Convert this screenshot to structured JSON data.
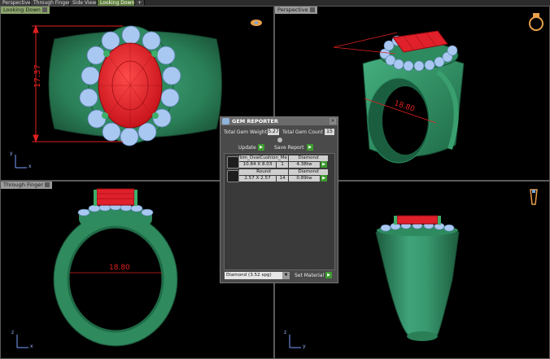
{
  "tabs": [
    {
      "label": "Perspective"
    },
    {
      "label": "Through Finger"
    },
    {
      "label": "Side View"
    },
    {
      "label": "Looking Down"
    },
    {
      "label": "+"
    }
  ],
  "viewports": {
    "top_left": {
      "label": "Looking Down",
      "dimension": "17.37"
    },
    "top_right": {
      "label": "Perspective",
      "dimension": "18.80"
    },
    "bottom_left": {
      "label": "Through Finger",
      "dimension": "18.80"
    },
    "bottom_right": {
      "label": ""
    }
  },
  "axes": {
    "x": "x",
    "y": "y",
    "z": "z"
  },
  "gem_reporter": {
    "title": "GEM REPORTER",
    "total_weight_label": "Total Gem Weight",
    "total_weight_value": "5.27",
    "total_count_label": "Total Gem Count",
    "total_count_value": "15",
    "update_label": "Update",
    "save_label": "Save Report",
    "gems": [
      {
        "name": "bm_OvalCushion_Me",
        "size": "10.84 X 8.03",
        "type": "Diamond",
        "count": "1",
        "weight": "4.38tw"
      },
      {
        "name": "Round",
        "size": "2.57 X 2.57",
        "type": "Diamond",
        "count": "14",
        "weight": "0.89tw"
      }
    ],
    "material_select": "Diamond   (3.52 spg)",
    "set_material_label": "Set Material"
  },
  "colors": {
    "metal": "#2f8a5e",
    "ruby": "#e0202a",
    "diamond": "#9ec4f0",
    "dimension": "#e02020"
  }
}
